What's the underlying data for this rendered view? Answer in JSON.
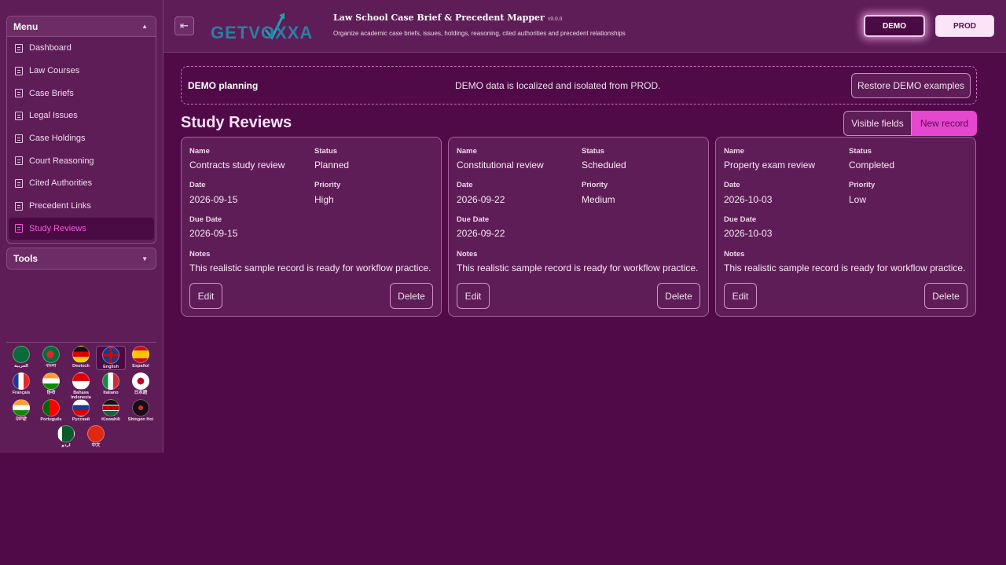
{
  "sidebar": {
    "menu_title": "Menu",
    "tools_title": "Tools",
    "items": [
      {
        "label": "Dashboard"
      },
      {
        "label": "Law Courses"
      },
      {
        "label": "Case Briefs"
      },
      {
        "label": "Legal Issues"
      },
      {
        "label": "Case Holdings"
      },
      {
        "label": "Court Reasoning"
      },
      {
        "label": "Cited Authorities"
      },
      {
        "label": "Precedent Links"
      },
      {
        "label": "Study Reviews"
      }
    ],
    "active_item": "Study Reviews",
    "languages": [
      {
        "label": "العربية",
        "flag": "saudi-arabia"
      },
      {
        "label": "বাংলা",
        "flag": "bangladesh"
      },
      {
        "label": "Deutsch",
        "flag": "germany"
      },
      {
        "label": "English",
        "flag": "united-kingdom",
        "selected": true
      },
      {
        "label": "Español",
        "flag": "spain"
      },
      {
        "label": "Français",
        "flag": "france"
      },
      {
        "label": "हिन्दी",
        "flag": "india"
      },
      {
        "label": "Bahasa Indonesia",
        "flag": "indonesia"
      },
      {
        "label": "Italiano",
        "flag": "italy"
      },
      {
        "label": "日本語",
        "flag": "japan"
      },
      {
        "label": "ਪੰਜਾਬੀ",
        "flag": "india"
      },
      {
        "label": "Português",
        "flag": "portugal"
      },
      {
        "label": "Русский",
        "flag": "russia"
      },
      {
        "label": "Kiswahili",
        "flag": "kenya"
      },
      {
        "label": "Shingon Hoi",
        "flag": "dark-emblem"
      },
      {
        "label": "اردو",
        "flag": "pakistan"
      },
      {
        "label": "中文",
        "flag": "china"
      }
    ]
  },
  "header": {
    "logo_text": "GETVOXXA",
    "title": "Law School Case Brief & Precedent Mapper",
    "version": "v9.0.0",
    "subtitle": "Organize academic case briefs, issues, holdings, reasoning, cited authorities and precedent relationships",
    "demo_label": "DEMO",
    "prod_label": "PROD"
  },
  "banner": {
    "title": "DEMO planning",
    "message": "DEMO data is localized and isolated from PROD.",
    "restore_label": "Restore DEMO examples"
  },
  "page": {
    "title": "Study Reviews",
    "visible_fields_label": "Visible fields",
    "new_record_label": "New record"
  },
  "labels": {
    "name": "Name",
    "status": "Status",
    "date": "Date",
    "priority": "Priority",
    "due_date": "Due Date",
    "notes": "Notes",
    "edit": "Edit",
    "delete": "Delete"
  },
  "records": [
    {
      "name": "Contracts study review",
      "status": "Planned",
      "date": "2026-09-15",
      "priority": "High",
      "due_date": "2026-09-15",
      "notes": "This realistic sample record is ready for workflow practice."
    },
    {
      "name": "Constitutional review",
      "status": "Scheduled",
      "date": "2026-09-22",
      "priority": "Medium",
      "due_date": "2026-09-22",
      "notes": "This realistic sample record is ready for workflow practice."
    },
    {
      "name": "Property exam review",
      "status": "Completed",
      "date": "2026-10-03",
      "priority": "Low",
      "due_date": "2026-10-03",
      "notes": "This realistic sample record is ready for workflow practice."
    }
  ],
  "colors": {
    "background": "#4f0a47",
    "panel": "#5e1d57",
    "accent": "#e547cf",
    "active_text": "#f25ad9"
  }
}
